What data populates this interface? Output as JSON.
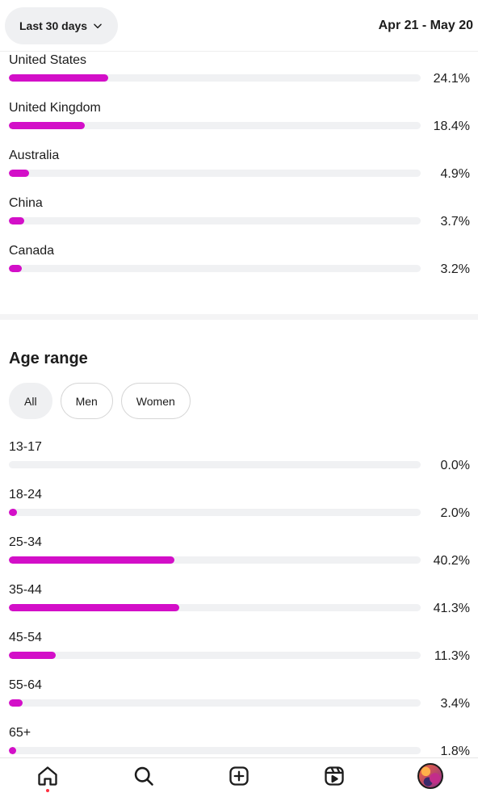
{
  "header": {
    "range_label": "Last 30 days",
    "date_range": "Apr 21 - May 20"
  },
  "countries": [
    {
      "label": "United States",
      "value": 24.1,
      "pct": "24.1%"
    },
    {
      "label": "United Kingdom",
      "value": 18.4,
      "pct": "18.4%"
    },
    {
      "label": "Australia",
      "value": 4.9,
      "pct": "4.9%"
    },
    {
      "label": "China",
      "value": 3.7,
      "pct": "3.7%"
    },
    {
      "label": "Canada",
      "value": 3.2,
      "pct": "3.2%"
    }
  ],
  "age": {
    "title": "Age range",
    "chips": [
      "All",
      "Men",
      "Women"
    ],
    "active_chip": "All",
    "ranges": [
      {
        "label": "13-17",
        "value": 0.0,
        "pct": "0.0%"
      },
      {
        "label": "18-24",
        "value": 2.0,
        "pct": "2.0%"
      },
      {
        "label": "25-34",
        "value": 40.2,
        "pct": "40.2%"
      },
      {
        "label": "35-44",
        "value": 41.3,
        "pct": "41.3%"
      },
      {
        "label": "45-54",
        "value": 11.3,
        "pct": "11.3%"
      },
      {
        "label": "55-64",
        "value": 3.4,
        "pct": "3.4%"
      },
      {
        "label": "65+",
        "value": 1.8,
        "pct": "1.8%"
      }
    ]
  },
  "colors": {
    "accent": "#d30fc8",
    "track": "#f0f1f3"
  },
  "nav": {
    "icons": [
      "home-icon",
      "search-icon",
      "create-icon",
      "reels-icon",
      "profile-avatar"
    ]
  }
}
